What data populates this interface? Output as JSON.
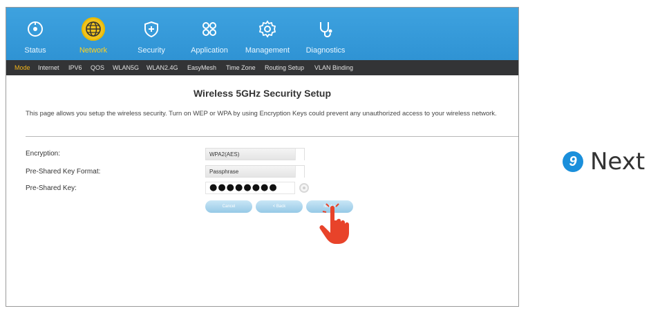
{
  "nav": {
    "items": [
      {
        "label": "Status",
        "icon": "status-icon"
      },
      {
        "label": "Network",
        "icon": "globe-icon"
      },
      {
        "label": "Security",
        "icon": "shield-icon"
      },
      {
        "label": "Application",
        "icon": "apps-icon"
      },
      {
        "label": "Management",
        "icon": "gear-icon"
      },
      {
        "label": "Diagnostics",
        "icon": "stethoscope-icon"
      }
    ],
    "active": "Network"
  },
  "subnav": {
    "items": [
      "Mode",
      "Internet",
      "IPV6",
      "QOS",
      "WLAN5G",
      "WLAN2.4G",
      "EasyMesh",
      "Time Zone",
      "Routing Setup",
      "VLAN Binding"
    ],
    "active": "Mode"
  },
  "page": {
    "title": "Wireless 5GHz Security Setup",
    "description": "This page allows you setup the wireless security. Turn on WEP or WPA by using Encryption Keys could prevent any unauthorized access to your wireless network."
  },
  "form": {
    "encryption_label": "Encryption:",
    "encryption_value": "WPA2(AES)",
    "psk_format_label": "Pre-Shared Key Format:",
    "psk_format_value": "Passphrase",
    "psk_label": "Pre-Shared Key:",
    "psk_value": "●●●●●●●●"
  },
  "buttons": {
    "cancel": "Cancel",
    "back": "< Back",
    "next": "Next >"
  },
  "instruction": {
    "step_number": "9",
    "step_text": "Next"
  },
  "colors": {
    "header": "#3ea2df",
    "subbar": "#333436",
    "active_nav": "#ffd21f",
    "button": "#96c9e6",
    "badge": "#1a8fdb",
    "hand": "#e8432a"
  }
}
